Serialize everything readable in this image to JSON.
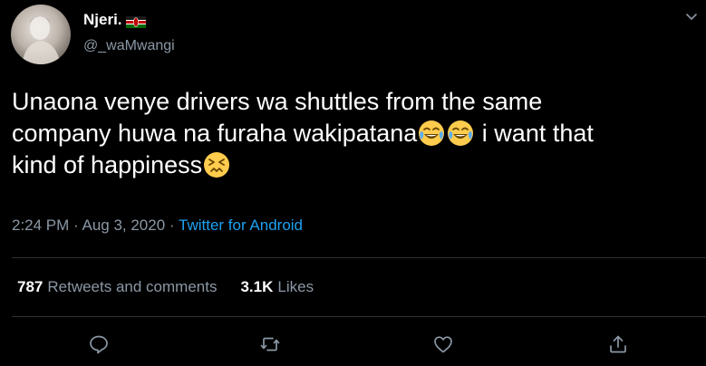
{
  "user": {
    "display_name": "Njeri.",
    "handle": "@_waMwangi",
    "flag_icon": "kenya-flag-icon"
  },
  "tweet": {
    "line1": "Unaona venye drivers wa shuttles from the same",
    "line2_pre": "company huwa na furaha wakipatana",
    "line2_post": " i want that",
    "line3": "kind of happiness",
    "emojis": [
      "face-with-tears-of-joy-icon",
      "face-with-tears-of-joy-icon",
      "persevering-face-icon"
    ]
  },
  "meta": {
    "time": "2:24 PM",
    "sep1": " · ",
    "date": "Aug 3, 2020",
    "sep2": " · ",
    "source": "Twitter for Android"
  },
  "stats": {
    "retweets_count": "787",
    "retweets_label": "Retweets and comments",
    "likes_count": "3.1K",
    "likes_label": "Likes"
  },
  "colors": {
    "background": "#000000",
    "text": "#ffffff",
    "secondary": "#8b98a5",
    "link": "#1da1f2",
    "divider": "#2f3336"
  }
}
